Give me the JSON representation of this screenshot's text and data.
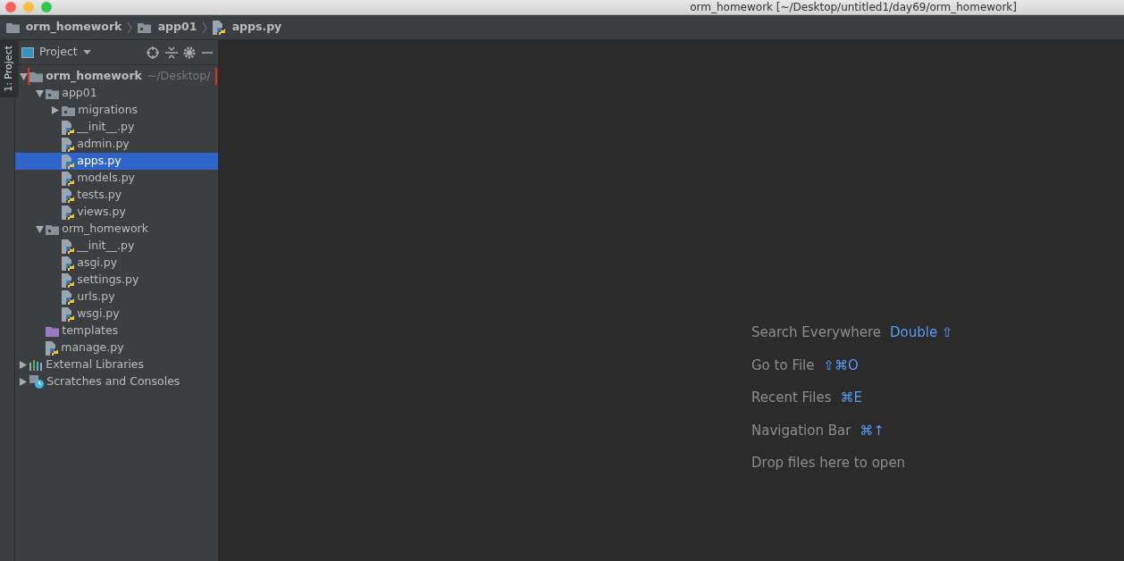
{
  "window": {
    "title": "orm_homework [~/Desktop/untitled1/day69/orm_homework]"
  },
  "breadcrumbs": [
    {
      "label": "orm_homework",
      "kind": "folder"
    },
    {
      "label": "app01",
      "kind": "module"
    },
    {
      "label": "apps.py",
      "kind": "python"
    }
  ],
  "side_stripe": {
    "label": "1: Project"
  },
  "project_panel": {
    "title": "Project",
    "tree": [
      {
        "label": "orm_homework",
        "path": "~/Desktop/",
        "kind": "folder",
        "expanded": true,
        "selected": false,
        "highlighted": true,
        "children": [
          {
            "label": "app01",
            "kind": "module",
            "expanded": true,
            "selected": false,
            "children": [
              {
                "label": "migrations",
                "kind": "module",
                "expanded": false,
                "selected": false
              },
              {
                "label": "__init__.py",
                "kind": "python",
                "selected": false
              },
              {
                "label": "admin.py",
                "kind": "python",
                "selected": false
              },
              {
                "label": "apps.py",
                "kind": "python",
                "selected": true
              },
              {
                "label": "models.py",
                "kind": "python",
                "selected": false
              },
              {
                "label": "tests.py",
                "kind": "python",
                "selected": false
              },
              {
                "label": "views.py",
                "kind": "python",
                "selected": false
              }
            ]
          },
          {
            "label": "orm_homework",
            "kind": "module",
            "expanded": true,
            "selected": false,
            "children": [
              {
                "label": "__init__.py",
                "kind": "python",
                "selected": false
              },
              {
                "label": "asgi.py",
                "kind": "python",
                "selected": false
              },
              {
                "label": "settings.py",
                "kind": "python",
                "selected": false
              },
              {
                "label": "urls.py",
                "kind": "python",
                "selected": false
              },
              {
                "label": "wsgi.py",
                "kind": "python",
                "selected": false
              }
            ]
          },
          {
            "label": "templates",
            "kind": "templates",
            "selected": false
          },
          {
            "label": "manage.py",
            "kind": "python",
            "selected": false
          }
        ]
      },
      {
        "label": "External Libraries",
        "kind": "libraries",
        "expanded": false,
        "selected": false
      },
      {
        "label": "Scratches and Consoles",
        "kind": "scratches",
        "expanded": false,
        "selected": false
      }
    ]
  },
  "editor_hints": [
    {
      "label": "Search Everywhere",
      "keys": "Double ⇧"
    },
    {
      "label": "Go to File",
      "keys": "⇧⌘O"
    },
    {
      "label": "Recent Files",
      "keys": "⌘E"
    },
    {
      "label": "Navigation Bar",
      "keys": "⌘↑"
    },
    {
      "label": "Drop files here to open"
    }
  ]
}
